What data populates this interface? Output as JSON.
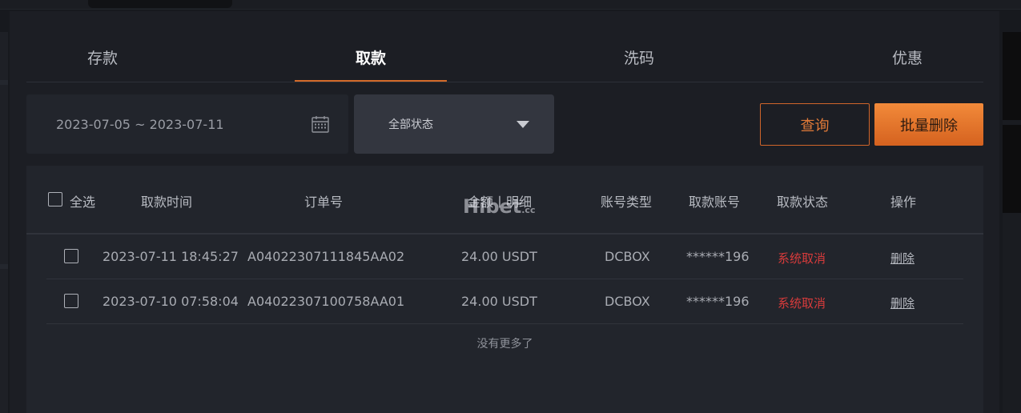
{
  "tabs": [
    {
      "label": "存款",
      "active": false
    },
    {
      "label": "取款",
      "active": true
    },
    {
      "label": "洗码",
      "active": false
    },
    {
      "label": "优惠",
      "active": false
    }
  ],
  "filters": {
    "date_range": "2023-07-05 ~ 2023-07-11",
    "status_selected": "全部状态",
    "query_label": "查询",
    "batch_delete_label": "批量删除"
  },
  "table": {
    "select_all_label": "全选",
    "headers": [
      "取款时间",
      "订单号",
      "金额丨明细",
      "账号类型",
      "取款账号",
      "取款状态",
      "操作"
    ],
    "rows": [
      {
        "time": "2023-07-11 18:45:27",
        "order": "A04022307111845AA02",
        "amount": "24.00 USDT",
        "account_type": "DCBOX",
        "account": "******196",
        "status": "系统取消",
        "action": "删除"
      },
      {
        "time": "2023-07-10 07:58:04",
        "order": "A04022307100758AA01",
        "amount": "24.00 USDT",
        "account_type": "DCBOX",
        "account": "******196",
        "status": "系统取消",
        "action": "删除"
      }
    ],
    "footer": "没有更多了"
  },
  "watermark": {
    "main": "Hibet",
    "suffix": ".cc"
  },
  "colors": {
    "accent": "#d36a2a",
    "status_cancel": "#d83b3b",
    "background": "#17191e"
  }
}
